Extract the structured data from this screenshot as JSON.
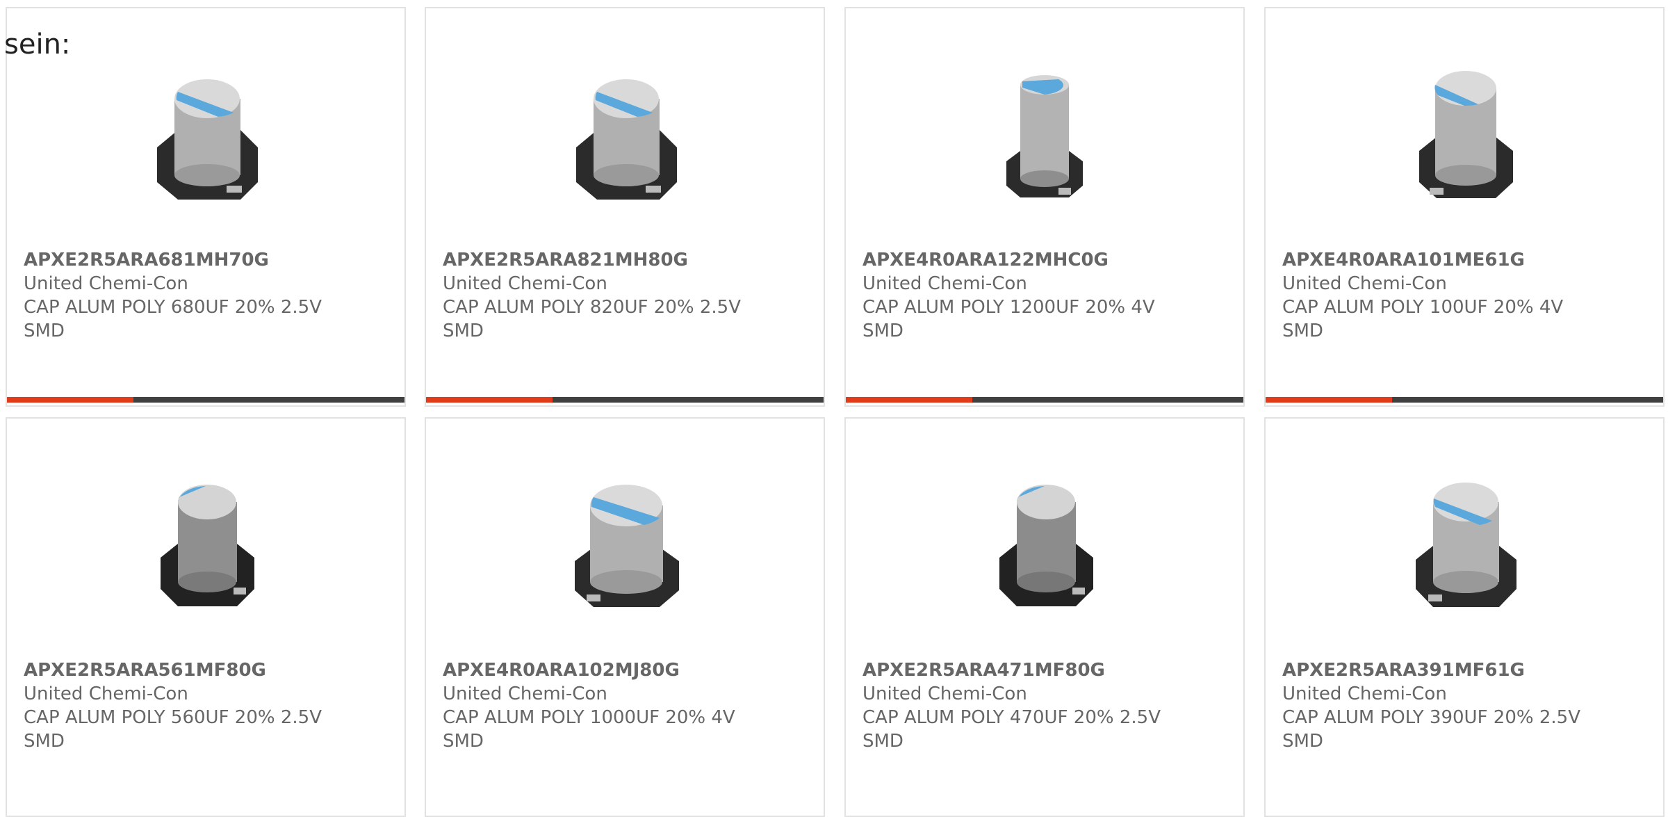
{
  "intro_text": "sein:",
  "colors": {
    "accent": "#e13b1a",
    "bar_dark": "#404040",
    "text": "#666666",
    "card_border": "#e2e2e2",
    "cap_blue": "#5aa8dc"
  },
  "products": [
    {
      "part_number": "APXE2R5ARA681MH70G",
      "manufacturer": "United Chemi-Con",
      "description": "CAP ALUM POLY 680UF 20% 2.5V",
      "package": "SMD",
      "image_icon": "capacitor-image"
    },
    {
      "part_number": "APXE2R5ARA821MH80G",
      "manufacturer": "United Chemi-Con",
      "description": "CAP ALUM POLY 820UF 20% 2.5V",
      "package": "SMD",
      "image_icon": "capacitor-image"
    },
    {
      "part_number": "APXE4R0ARA122MHC0G",
      "manufacturer": "United Chemi-Con",
      "description": "CAP ALUM POLY 1200UF 20% 4V",
      "package": "SMD",
      "image_icon": "capacitor-image"
    },
    {
      "part_number": "APXE4R0ARA101ME61G",
      "manufacturer": "United Chemi-Con",
      "description": "CAP ALUM POLY 100UF 20% 4V",
      "package": "SMD",
      "image_icon": "capacitor-image"
    },
    {
      "part_number": "APXE2R5ARA561MF80G",
      "manufacturer": "United Chemi-Con",
      "description": "CAP ALUM POLY 560UF 20% 2.5V",
      "package": "SMD",
      "image_icon": "capacitor-image"
    },
    {
      "part_number": "APXE4R0ARA102MJ80G",
      "manufacturer": "United Chemi-Con",
      "description": "CAP ALUM POLY 1000UF 20% 4V",
      "package": "SMD",
      "image_icon": "capacitor-image"
    },
    {
      "part_number": "APXE2R5ARA471MF80G",
      "manufacturer": "United Chemi-Con",
      "description": "CAP ALUM POLY 470UF 20% 2.5V",
      "package": "SMD",
      "image_icon": "capacitor-image"
    },
    {
      "part_number": "APXE2R5ARA391MF61G",
      "manufacturer": "United Chemi-Con",
      "description": "CAP ALUM POLY 390UF 20% 2.5V",
      "package": "SMD",
      "image_icon": "capacitor-image"
    }
  ]
}
